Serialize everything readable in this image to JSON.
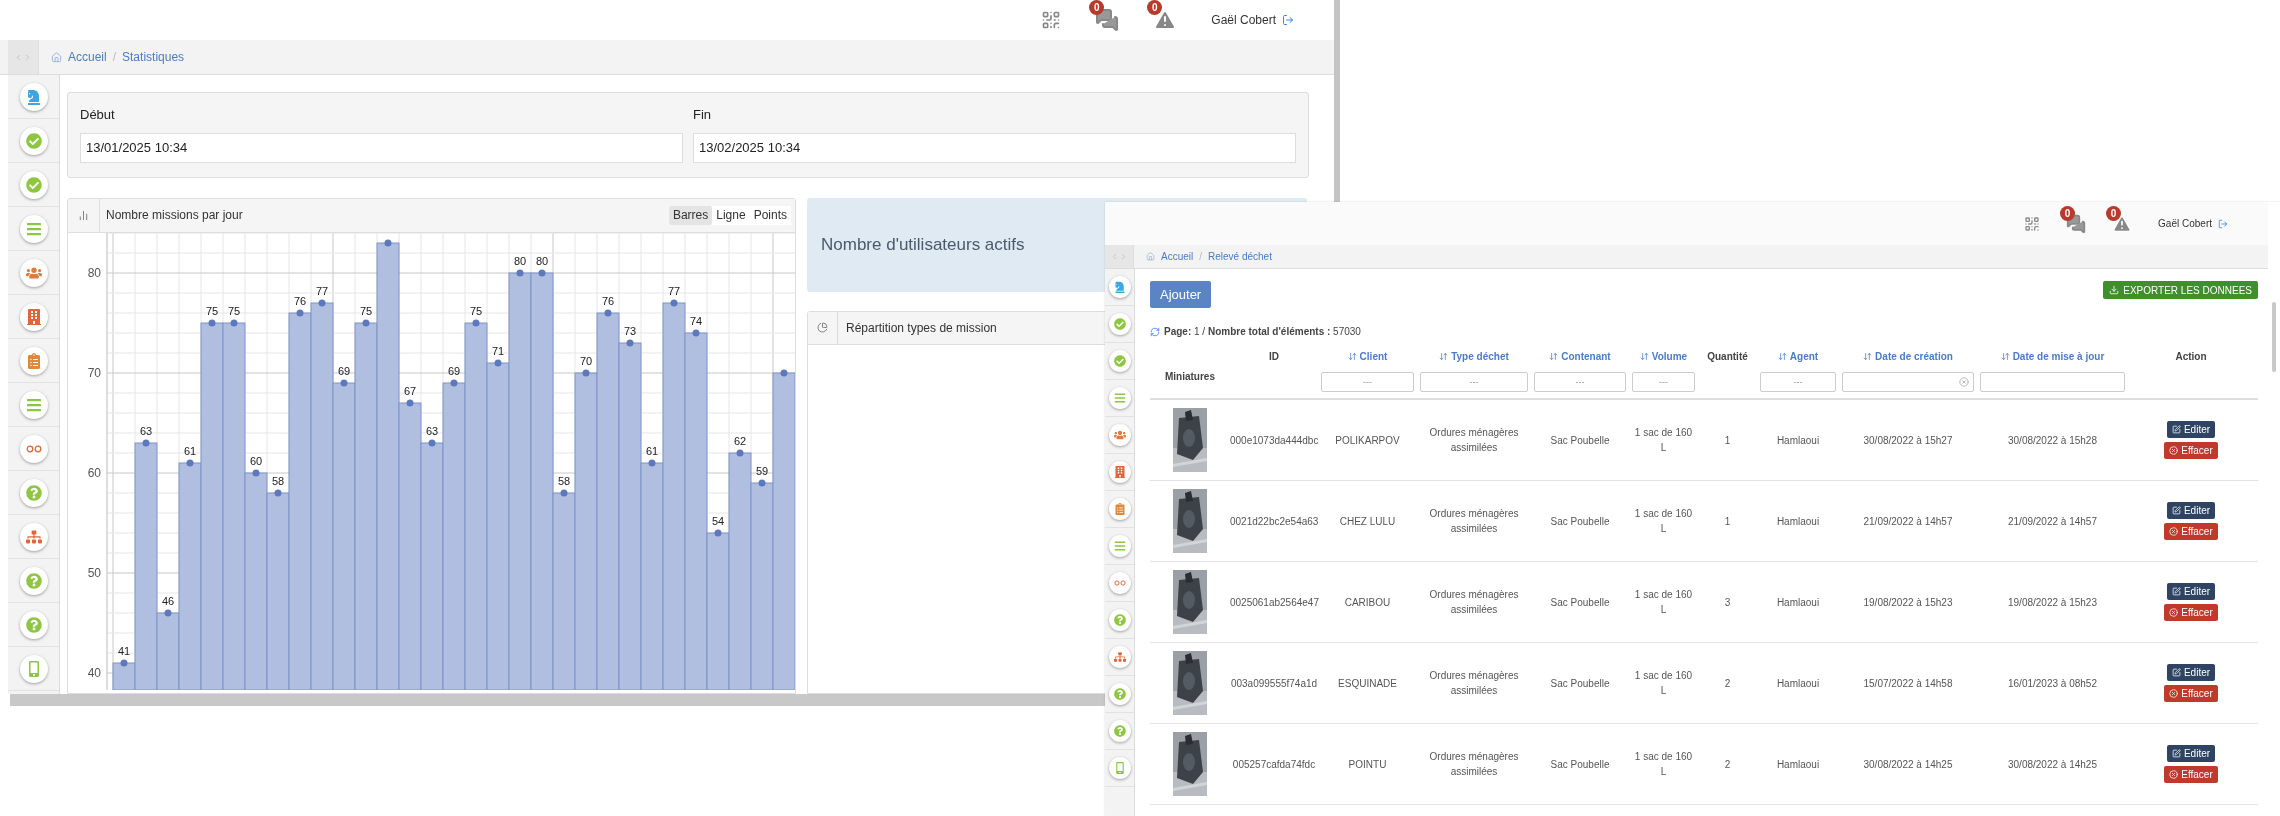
{
  "statistics_window": {
    "header": {
      "messages_badge": "0",
      "alerts_badge": "0",
      "user": "Gaël Cobert"
    },
    "breadcrumb": {
      "items": [
        "Accueil",
        "Statistiques"
      ],
      "separator": "/"
    },
    "date_filter": {
      "start": {
        "label": "Début",
        "value": "13/01/2025 10:34"
      },
      "end": {
        "label": "Fin",
        "value": "13/02/2025 10:34"
      }
    },
    "missions_chart": {
      "title": "Nombre missions par jour",
      "modes": [
        {
          "label": "Barres",
          "selected": true
        },
        {
          "label": "Ligne",
          "selected": false
        },
        {
          "label": "Points",
          "selected": false
        }
      ],
      "chart_data": {
        "type": "bar",
        "ylim": [
          38.3,
          84
        ],
        "yticks": [
          40,
          50,
          60,
          70,
          80
        ],
        "grid": true,
        "values": [
          41,
          63,
          46,
          61,
          75,
          75,
          60,
          58,
          76,
          77,
          69,
          75,
          83,
          67,
          63,
          69,
          75,
          71,
          80,
          80,
          58,
          70,
          76,
          73,
          61,
          77,
          74,
          54,
          62,
          59,
          70
        ],
        "value_labels": [
          "41",
          "63",
          "46",
          "61",
          "75",
          "75",
          "60",
          "58",
          "76",
          "77",
          "69",
          "75",
          null,
          "67",
          "63",
          "69",
          "75",
          "71",
          "80",
          "80",
          "58",
          "70",
          "76",
          "73",
          "61",
          "77",
          "74",
          "54",
          "62",
          "59",
          null
        ]
      }
    },
    "active_users_panel": {
      "title": "Nombre d'utilisateurs actifs"
    },
    "mission_types_panel": {
      "title": "Répartition types de mission"
    }
  },
  "waste_window": {
    "header": {
      "messages_badge": "0",
      "alerts_badge": "0",
      "user": "Gaël Cobert"
    },
    "breadcrumb": {
      "items": [
        "Accueil",
        "Relevé déchet"
      ],
      "separator": "/"
    },
    "add_button": "Ajouter",
    "export_button": "EXPORTER LES DONNEES",
    "pagination": "**Page:** 1 / **Nombre total d'éléments :** 57030",
    "table": {
      "columns": [
        {
          "label": "Miniatures",
          "sortable": false
        },
        {
          "label": "ID",
          "sortable": false
        },
        {
          "label": "Client",
          "sortable": true,
          "filter": {
            "kind": "text",
            "placeholder": "---"
          }
        },
        {
          "label": "Type déchet",
          "sortable": true,
          "filter": {
            "kind": "text",
            "placeholder": "---"
          }
        },
        {
          "label": "Contenant",
          "sortable": true,
          "filter": {
            "kind": "text",
            "placeholder": "---"
          }
        },
        {
          "label": "Volume",
          "sortable": true,
          "filter": {
            "kind": "text",
            "placeholder": "---"
          }
        },
        {
          "label": "Quantité",
          "sortable": false
        },
        {
          "label": "Agent",
          "sortable": true,
          "filter": {
            "kind": "text",
            "placeholder": "---"
          }
        },
        {
          "label": "Date de création",
          "sortable": true,
          "filter": {
            "kind": "date"
          }
        },
        {
          "label": "Date de mise à jour",
          "sortable": true,
          "filter": {
            "kind": "text"
          }
        },
        {
          "label": "Action",
          "sortable": false
        }
      ],
      "rows": [
        {
          "id": "000e1073da444dbc",
          "client": "POLIKARPOV",
          "waste_type": "Ordures ménagères assimilées",
          "container": "Sac Poubelle",
          "volume": "1 sac de 160 L",
          "quantity": "1",
          "agent": "Hamlaoui",
          "created": "30/08/2022 à 15h27",
          "updated": "30/08/2022 à 15h28",
          "edit": "Editer",
          "delete": "Effacer"
        },
        {
          "id": "0021d22bc2e54a63",
          "client": "CHEZ LULU",
          "waste_type": "Ordures ménagères assimilées",
          "container": "Sac Poubelle",
          "volume": "1 sac de 160 L",
          "quantity": "1",
          "agent": "Hamlaoui",
          "created": "21/09/2022 à 14h57",
          "updated": "21/09/2022 à 14h57",
          "edit": "Editer",
          "delete": "Effacer"
        },
        {
          "id": "0025061ab2564e47",
          "client": "CARIBOU",
          "waste_type": "Ordures ménagères assimilées",
          "container": "Sac Poubelle",
          "volume": "1 sac de 160 L",
          "quantity": "3",
          "agent": "Hamlaoui",
          "created": "19/08/2022 à 15h23",
          "updated": "19/08/2022 à 15h23",
          "edit": "Editer",
          "delete": "Effacer"
        },
        {
          "id": "003a099555f74a1d",
          "client": "ESQUINADE",
          "waste_type": "Ordures ménagères assimilées",
          "container": "Sac Poubelle",
          "volume": "1 sac de 160 L",
          "quantity": "2",
          "agent": "Hamlaoui",
          "created": "15/07/2022 à 14h58",
          "updated": "16/01/2023 à 08h52",
          "edit": "Editer",
          "delete": "Effacer"
        },
        {
          "id": "005257cafda74fdc",
          "client": "POINTU",
          "waste_type": "Ordures ménagères assimilées",
          "container": "Sac Poubelle",
          "volume": "1 sac de 160 L",
          "quantity": "2",
          "agent": "Hamlaoui",
          "created": "30/08/2022 à 14h25",
          "updated": "30/08/2022 à 14h25",
          "edit": "Editer",
          "delete": "Effacer"
        }
      ]
    }
  }
}
